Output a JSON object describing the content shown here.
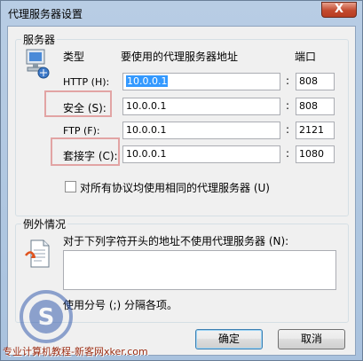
{
  "window": {
    "title": "代理服务器设置",
    "close_glyph": "X"
  },
  "servers": {
    "group_title": "服务器",
    "col_type": "类型",
    "col_address": "要使用的代理服务器地址",
    "col_port": "端口",
    "rows": [
      {
        "label": "HTTP (H):",
        "address": "10.0.0.1",
        "port": "808",
        "selected": true
      },
      {
        "label": "安全 (S):",
        "address": "10.0.0.1",
        "port": "808"
      },
      {
        "label": "FTP (F):",
        "address": "10.0.0.1",
        "port": "2121"
      },
      {
        "label": "套接字 (C):",
        "address": "10.0.0.1",
        "port": "1080"
      }
    ],
    "colon": ":",
    "same_proxy_label": "对所有协议均使用相同的代理服务器 (U)",
    "same_proxy_checked": false
  },
  "exceptions": {
    "group_title": "例外情况",
    "description": "对于下列字符开头的地址不使用代理服务器 (N):",
    "value": "",
    "hint": "使用分号 (;) 分隔各项。"
  },
  "buttons": {
    "ok": "确定",
    "cancel": "取消"
  },
  "watermark": {
    "text": "专业计算机教程-新客网xker.com"
  },
  "colors": {
    "highlight_box": "#e2a4a4",
    "selection": "#3399ff",
    "close": "#c24a2e"
  }
}
